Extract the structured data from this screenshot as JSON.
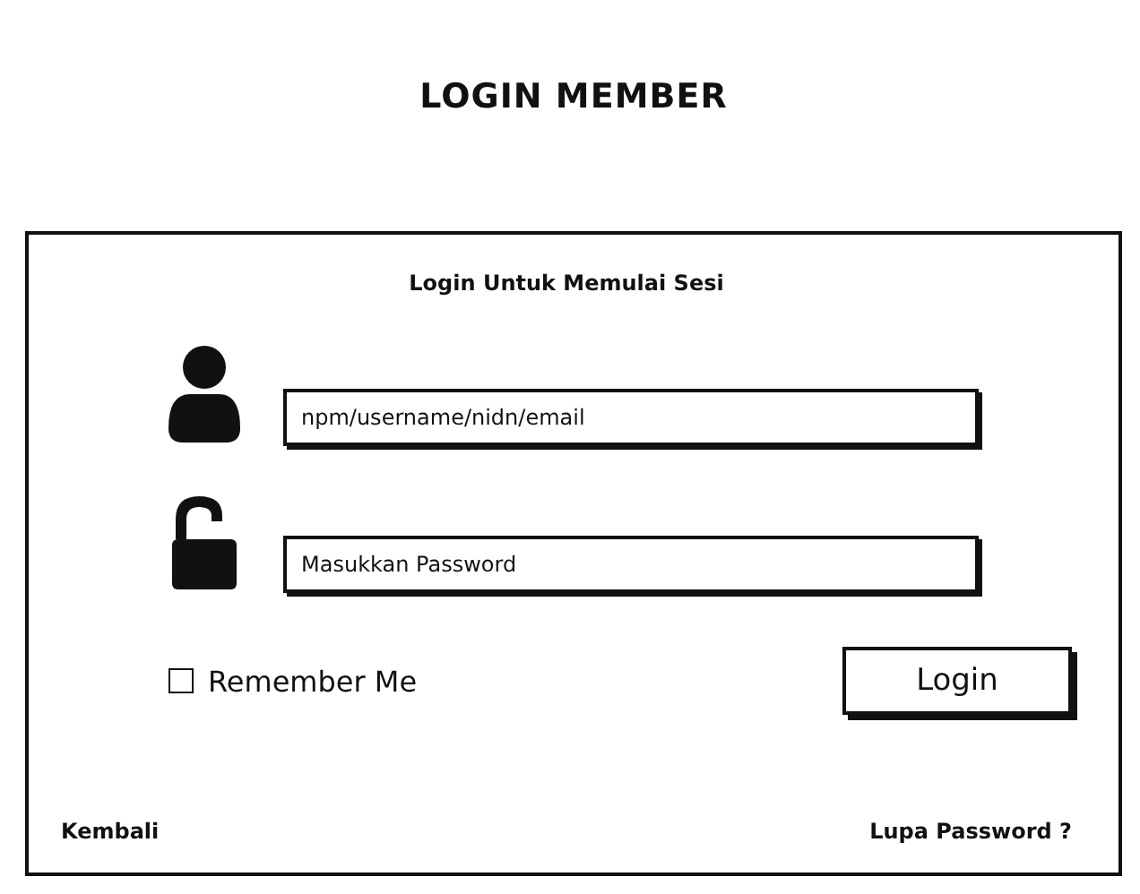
{
  "page_title": "LOGIN MEMBER",
  "form": {
    "heading": "Login Untuk Memulai Sesi",
    "fields": [
      {
        "kind": "user",
        "placeholder": "npm/username/nidn/email"
      },
      {
        "kind": "password",
        "placeholder": "Masukkan Password"
      }
    ],
    "remember": {
      "label": "Remember Me",
      "checked": false
    },
    "submit": "Login",
    "links": [
      "Kembali",
      "Lupa Password ?"
    ]
  }
}
